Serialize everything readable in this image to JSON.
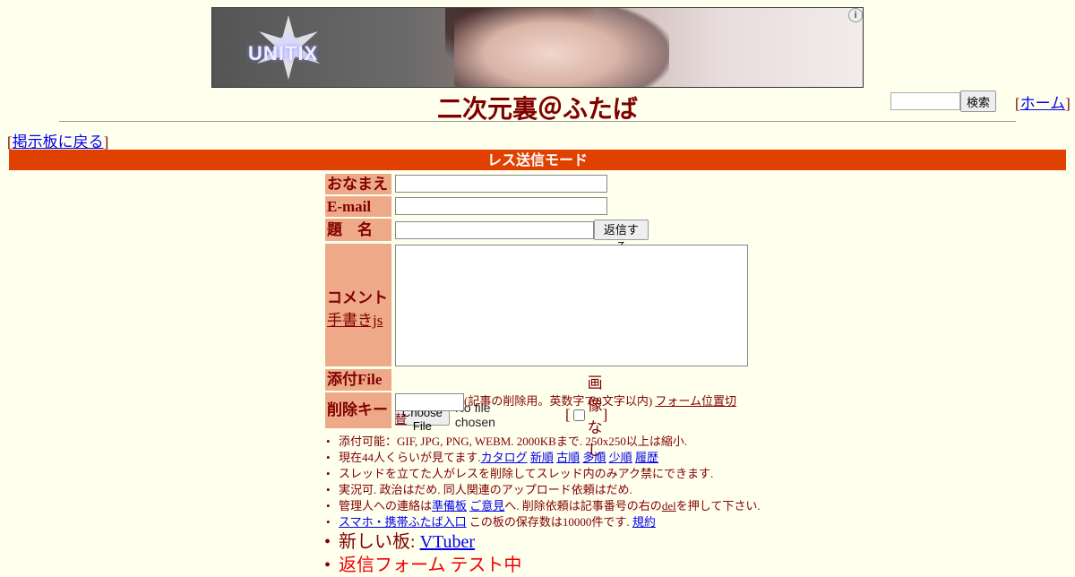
{
  "banner": {
    "logo_text": "UNITIX",
    "info_icon": "info-icon"
  },
  "header": {
    "title": "二次元裏＠ふたば",
    "search_placeholder": "",
    "search_button": "検索",
    "home_link": "ホーム",
    "bracket_open": "[",
    "bracket_close": "]"
  },
  "nav": {
    "back_link": "掲示板に戻る"
  },
  "mode_bar": {
    "label": "レス送信モード"
  },
  "form": {
    "name_label": "おなまえ",
    "email_label": "E-mail",
    "subject_label": "題　名",
    "reply_button": "返信する",
    "comment_label": "コメント",
    "handwrite_link": "手書きjs",
    "file_label": "添付File",
    "file_button": "Choose File",
    "file_status": "No file chosen",
    "noimage_label": "画像なし",
    "delkey_label": "削除キー",
    "delkey_note": "(記事の削除用。英数字で8文字以内)",
    "form_position_link": "フォーム位置切替"
  },
  "notes": {
    "line1": "添付可能：GIF, JPG, PNG, WEBM. 2000KBまで. 250x250以上は縮小.",
    "line2_prefix": "現在44人くらいが見てます.",
    "line2_links": [
      "カタログ",
      "新順",
      "古順",
      "多順",
      "少順",
      "履歴"
    ],
    "line3": "スレッドを立てた人がレスを削除してスレッド内のみアク禁にできます.",
    "line4": "実況可. 政治はだめ. 同人関連のアップロード依頼はだめ.",
    "line5_prefix": "管理人への連絡は",
    "line5_link1": "準備板",
    "line5_link2": "ご意見",
    "line5_mid": "へ. 削除依頼は記事番号の右の",
    "line5_del": "del",
    "line5_suffix": "を押して下さい.",
    "line6_link": "スマホ・携帯ふたば入口",
    "line6_mid": " この板の保存数は10000件です. ",
    "line6_link2": "規約",
    "line7_prefix": "新しい板: ",
    "line7_link": "VTuber",
    "line8": "返信フォーム テスト中"
  },
  "colors": {
    "background": "#ffffee",
    "text": "#800000",
    "mode_bar": "#e04000",
    "label_bg": "#eeaa88"
  }
}
